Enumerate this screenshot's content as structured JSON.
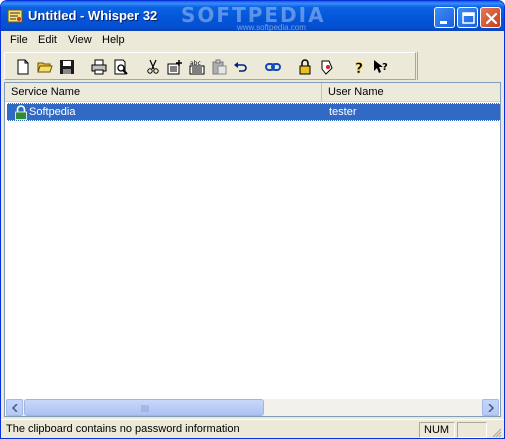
{
  "window": {
    "title": "Untitled - Whisper 32",
    "watermark": "SOFTPEDIA",
    "watermark_sub": "www.softpedia.com",
    "accent": "#0454d8",
    "close_color": "#c2401a"
  },
  "menu": {
    "items": [
      {
        "label": "File"
      },
      {
        "label": "Edit"
      },
      {
        "label": "View"
      },
      {
        "label": "Help"
      }
    ]
  },
  "toolbar": {
    "buttons": [
      {
        "icon": "new-file-icon"
      },
      {
        "icon": "open-folder-icon"
      },
      {
        "icon": "save-disk-icon"
      },
      {
        "icon": "print-icon"
      },
      {
        "icon": "print-preview-icon"
      },
      {
        "icon": "cut-icon"
      },
      {
        "icon": "add-entry-icon"
      },
      {
        "icon": "find-replace-icon"
      },
      {
        "icon": "paste-icon"
      },
      {
        "icon": "undo-icon"
      },
      {
        "icon": "link-icon"
      },
      {
        "icon": "lock-icon"
      },
      {
        "icon": "key-record-icon"
      },
      {
        "icon": "help-icon"
      },
      {
        "icon": "context-help-icon"
      }
    ]
  },
  "list": {
    "columns": [
      {
        "label": "Service Name"
      },
      {
        "label": "User Name"
      }
    ],
    "rows": [
      {
        "service": "Softpedia",
        "user": "tester",
        "selected": true,
        "selection_color": "#316ac5"
      }
    ]
  },
  "status": {
    "message": "The clipboard contains no password information",
    "num": "NUM"
  }
}
